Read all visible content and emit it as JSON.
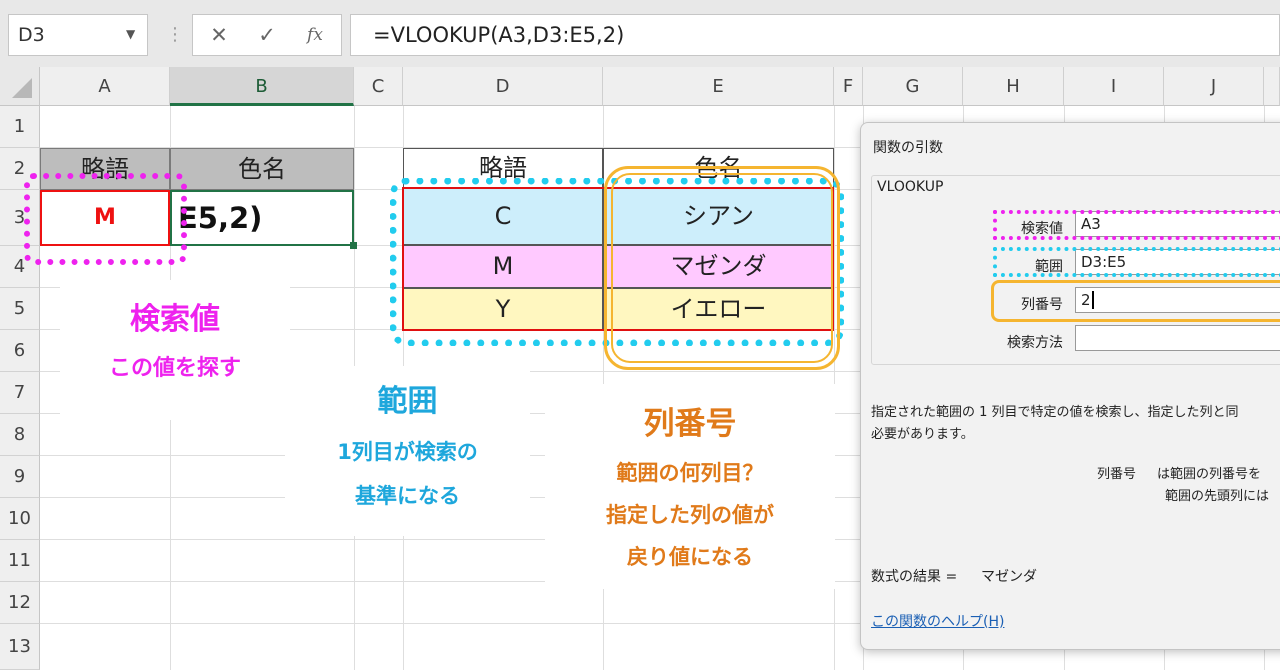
{
  "formula_bar": {
    "name_box": "D3",
    "cancel_icon": "✕",
    "enter_icon": "✓",
    "fx_icon": "fx",
    "formula": "=VLOOKUP(A3,D3:E5,2)"
  },
  "columns": [
    "A",
    "B",
    "C",
    "D",
    "E",
    "F",
    "G",
    "H",
    "I",
    "J"
  ],
  "selected_column": "B",
  "rows": [
    "1",
    "2",
    "3",
    "4",
    "5",
    "6",
    "7",
    "8",
    "9",
    "10",
    "11",
    "12",
    "13"
  ],
  "left_table": {
    "header_abbr": "略語",
    "header_color": "色名",
    "a3_value": "M",
    "b3_display": "E5,2)"
  },
  "right_table": {
    "header_abbr": "略語",
    "header_color": "色名",
    "rows": [
      {
        "abbr": "C",
        "color": "シアン"
      },
      {
        "abbr": "M",
        "color": "マゼンダ"
      },
      {
        "abbr": "Y",
        "color": "イエロー"
      }
    ]
  },
  "callouts": {
    "lookup_value": {
      "title": "検索値",
      "line1": "この値を探す"
    },
    "range": {
      "title": "範囲",
      "line1": "1列目が検索の",
      "line2": "基準になる"
    },
    "col_index": {
      "title": "列番号",
      "line1": "範囲の何列目？",
      "line2": "指定した列の値が",
      "line3": "戻り値になる"
    }
  },
  "dialog": {
    "title": "関数の引数",
    "function_name": "VLOOKUP",
    "args": [
      {
        "label": "検索値",
        "value": "A3"
      },
      {
        "label": "範囲",
        "value": "D3:E5"
      },
      {
        "label": "列番号",
        "value": "2"
      },
      {
        "label": "検索方法",
        "value": ""
      }
    ],
    "description1": "指定された範囲の 1 列目で特定の値を検索し、指定した列と同",
    "description2": "必要があります。",
    "arg_help_label": "列番号",
    "arg_help_line1": "は範囲の列番号を",
    "arg_help_line2": "範囲の先頭列には",
    "result_label": "数式の結果 =",
    "result_value": "マゼンダ",
    "help_link": "この関数のヘルプ(H)"
  },
  "colors": {
    "magenta": "#ee22ee",
    "cyan": "#22ccee",
    "orange": "#f5b530",
    "range_text": "#1ea7dc",
    "colindex_text": "#e07a1a",
    "excel_green": "#217346",
    "row_cyan": "#cdeefb",
    "row_magenta": "#ffc9ff",
    "row_yellow": "#fff7c0"
  }
}
